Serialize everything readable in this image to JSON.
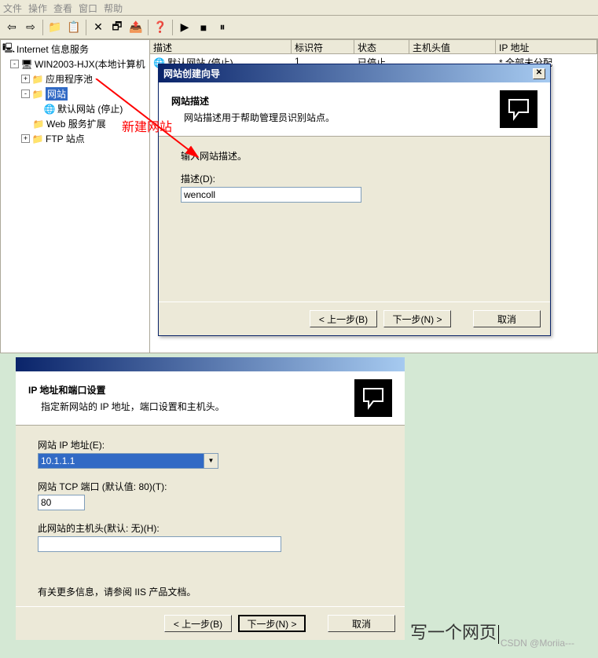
{
  "menubar": {
    "items": [
      "文件",
      "操作",
      "查看",
      "窗口",
      "帮助"
    ]
  },
  "tree": {
    "root": "Internet 信息服务",
    "server": "WIN2003-HJX(本地计算机",
    "app_pool": "应用程序池",
    "websites": "网站",
    "default_site": "默认网站 (停止)",
    "web_ext": "Web 服务扩展",
    "ftp": "FTP 站点"
  },
  "list": {
    "cols": [
      "描述",
      "标识符",
      "状态",
      "主机头值",
      "IP 地址"
    ],
    "row": {
      "desc": "默认网站 (停止)",
      "id": "1",
      "status": "已停止",
      "host": "",
      "ip": "* 全部未分配"
    }
  },
  "annotation": "新建网站",
  "dialog1": {
    "title": "网站创建向导",
    "header_title": "网站描述",
    "header_sub": "网站描述用于帮助管理员识别站点。",
    "body_text": "输入网站描述。",
    "field_label": "描述(D):",
    "field_value": "wencoll",
    "btn_back": "< 上一步(B)",
    "btn_next": "下一步(N) >",
    "btn_cancel": "取消"
  },
  "dialog2": {
    "header_title": "IP 地址和端口设置",
    "header_sub": "指定新网站的 IP 地址，端口设置和主机头。",
    "ip_label": "网站 IP 地址(E):",
    "ip_value": "10.1.1.1",
    "port_label": "网站 TCP 端口 (默认值: 80)(T):",
    "port_value": "80",
    "host_label": "此网站的主机头(默认: 无)(H):",
    "host_value": "",
    "info": "有关更多信息，请参阅 IIS 产品文档。",
    "btn_back": "< 上一步(B)",
    "btn_next": "下一步(N) >",
    "btn_cancel": "取消"
  },
  "handwriting": "写一个网页",
  "watermark": "CSDN @Moriia---"
}
